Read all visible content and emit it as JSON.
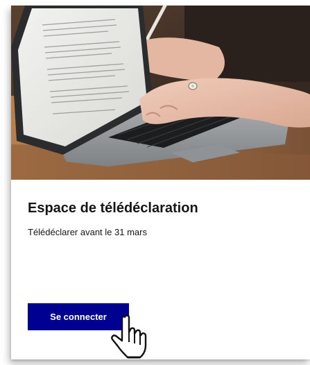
{
  "card": {
    "title": "Espace de télédéclaration",
    "subtitle": "Télédéclarer avant le 31 mars",
    "button_label": "Se connecter"
  },
  "image": {
    "subject": "laptop-typing-photo"
  },
  "cursor": {
    "icon": "hand-pointer-icon"
  },
  "colors": {
    "button_background": "#000091",
    "button_text": "#ffffff",
    "text": "#161616"
  }
}
